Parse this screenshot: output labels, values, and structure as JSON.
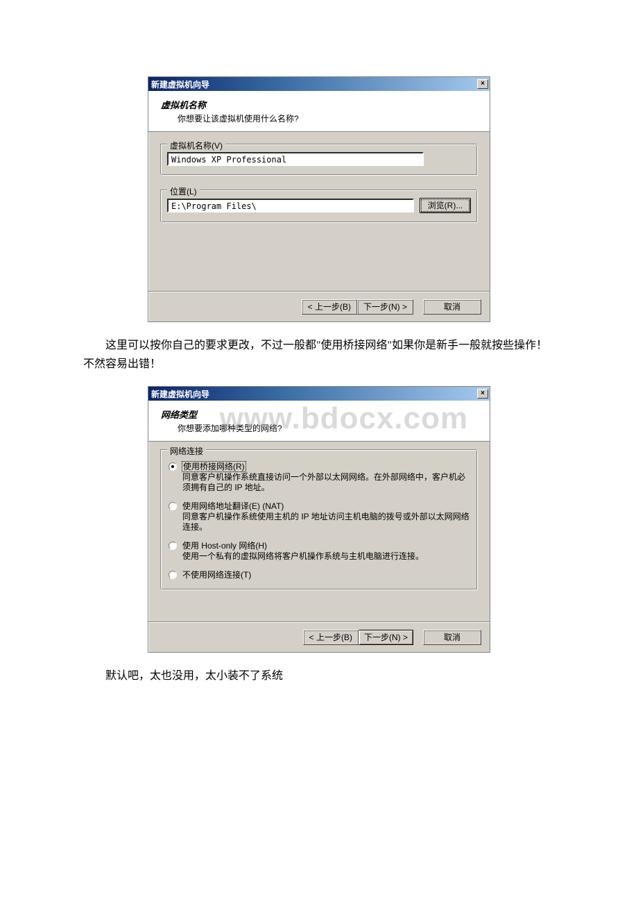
{
  "watermark": "www.bdocx.com",
  "dialog1": {
    "title": "新建虚拟机向导",
    "header_h1": "虚拟机名称",
    "header_sub": "你想要让该虚拟机使用什么名称?",
    "legend_name": "虚拟机名称(V)",
    "input_name": "Windows XP Professional",
    "legend_location": "位置(L)",
    "input_location": "E:\\Program Files\\",
    "browse_btn": "浏览(R)...",
    "back_btn": "< 上一步(B)",
    "next_btn": "下一步(N) >",
    "cancel_btn": "取消"
  },
  "para1": "这里可以按你自己的要求更改，不过一般都\"使用桥接网络\"如果你是新手一般就按些操作！不然容易出错！",
  "dialog2": {
    "title": "新建虚拟机向导",
    "header_h1": "网络类型",
    "header_sub": "你想要添加哪种类型的网络?",
    "legend_net": "网络连接",
    "opt_bridged_label": "使用桥接网络(R)",
    "opt_bridged_desc": "同意客户机操作系统直接访问一个外部以太网网络。在外部网络中，客户机必须拥有自己的 IP 地址。",
    "opt_nat_label": "使用网络地址翻译(E)  (NAT)",
    "opt_nat_desc": "同意客户机操作系统使用主机的 IP 地址访问主机电脑的拨号或外部以太网网络连接。",
    "opt_host_label": "使用 Host-only 网络(H)",
    "opt_host_desc": "使用一个私有的虚拟网络将客户机操作系统与主机电脑进行连接。",
    "opt_none_label": "不使用网络连接(T)",
    "back_btn": "< 上一步(B)",
    "next_btn": "下一步(N) >",
    "cancel_btn": "取消"
  },
  "para2": "默认吧，太也没用，太小装不了系统"
}
